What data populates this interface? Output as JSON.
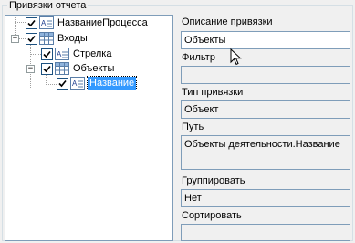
{
  "group": {
    "title": "Привязки отчета"
  },
  "tree": {
    "nodes": [
      {
        "label": "НазваниеПроцесса",
        "icon": "text-field-icon",
        "checked": true
      },
      {
        "label": "Входы",
        "icon": "table-icon",
        "checked": true,
        "expander": "−"
      },
      {
        "label": "Стрелка",
        "icon": "text-field-icon",
        "checked": true
      },
      {
        "label": "Объекты",
        "icon": "table-icon",
        "checked": true,
        "expander": "−"
      },
      {
        "label": "Название",
        "icon": "text-field-icon",
        "checked": true,
        "selected": true
      }
    ]
  },
  "fields": {
    "description": {
      "label": "Описание привязки",
      "value": "Объекты"
    },
    "filter": {
      "label": "Фильтр",
      "value": ""
    },
    "binding_type": {
      "label": "Тип привязки",
      "value": "Объект"
    },
    "path": {
      "label": "Путь",
      "value": "Объекты деятельности.Название"
    },
    "group_by": {
      "label": "Группировать",
      "value": "Нет"
    },
    "sort": {
      "label": "Сортировать",
      "value": ""
    }
  },
  "colors": {
    "selection": "#3399ff",
    "panel": "#f0f0f0",
    "border": "#7f9db9"
  }
}
